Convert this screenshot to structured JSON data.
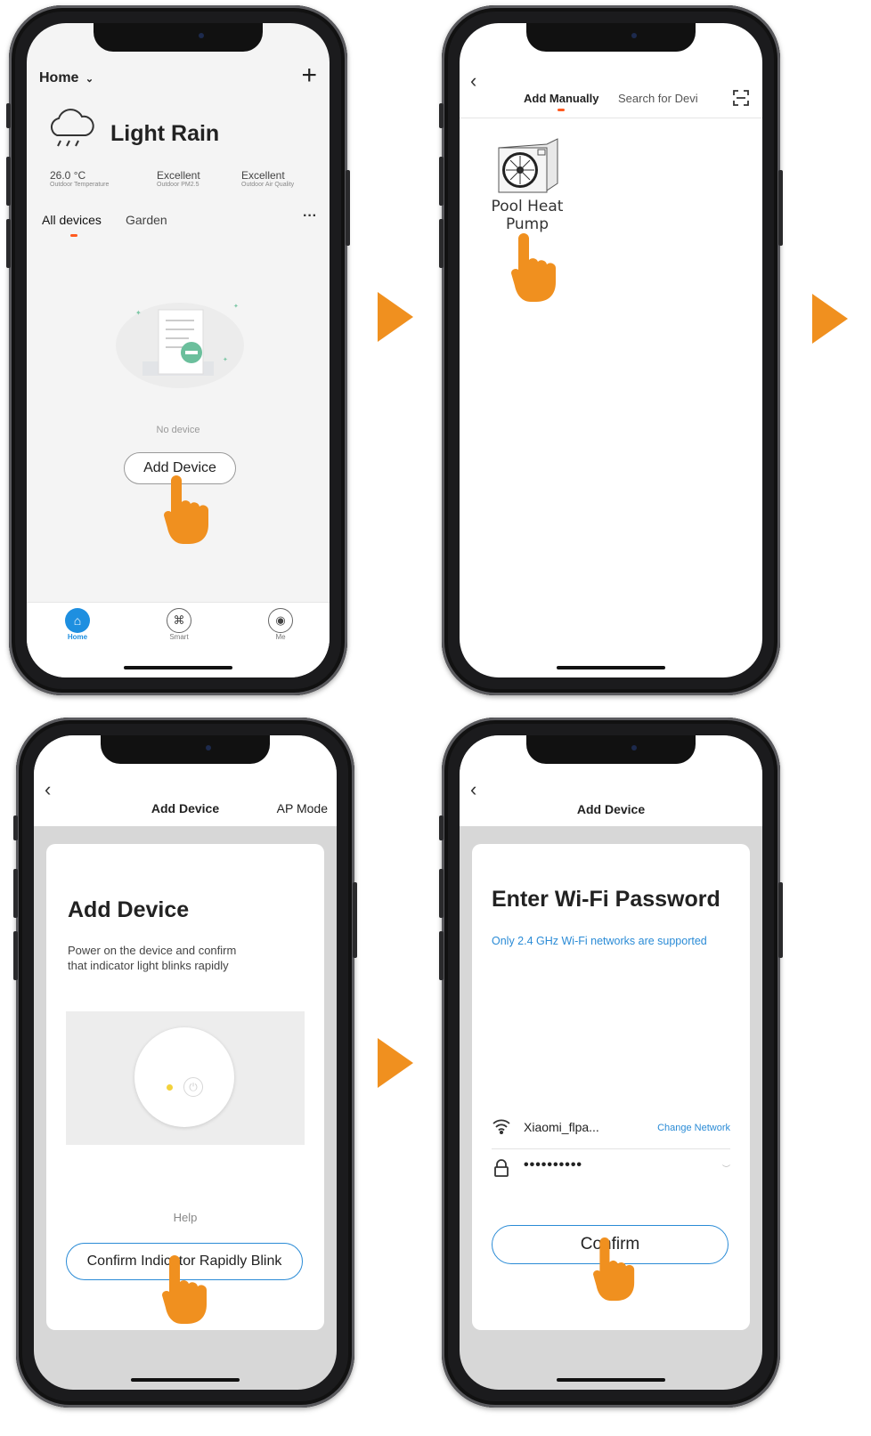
{
  "colors": {
    "accent_orange": "#f0901f",
    "tab_underline": "#ff5a1f",
    "link_blue": "#2a8bd6",
    "home_blue": "#1e8fe0"
  },
  "screen1": {
    "home_label": "Home",
    "weather_title": "Light Rain",
    "stats": [
      {
        "value": "26.0 °C",
        "label": "Outdoor Temperature"
      },
      {
        "value": "Excellent",
        "label": "Outdoor PM2.5"
      },
      {
        "value": "Excellent",
        "label": "Outdoor Air Quality"
      }
    ],
    "tabs": [
      "All devices",
      "Garden"
    ],
    "more": "···",
    "empty_text": "No device",
    "add_button": "Add Device",
    "bottom_nav": [
      "Home",
      "Smart",
      "Me"
    ],
    "icons": {
      "add": "plus-icon",
      "weather": "rain-cloud-icon",
      "chevron": "chevron-down-icon"
    }
  },
  "screen2": {
    "tabs": [
      "Add Manually",
      "Search for Devi"
    ],
    "device_label_line1": "Pool Heat",
    "device_label_line2": "Pump",
    "icons": {
      "back": "back-chevron-icon",
      "scan": "scan-icon"
    }
  },
  "screen3": {
    "header_title": "Add Device",
    "header_right": "AP Mode",
    "card_title": "Add Device",
    "card_desc_line1": "Power on the device and confirm",
    "card_desc_line2": "that indicator light blinks rapidly",
    "help": "Help",
    "confirm_button": "Confirm Indicator Rapidly Blink"
  },
  "screen4": {
    "header_title": "Add Device",
    "card_title": "Enter Wi-Fi Password",
    "subtitle": "Only 2.4 GHz Wi-Fi networks are supported",
    "network_name": "Xiaomi_flpa...",
    "change_network": "Change Network",
    "password_mask": "••••••••••",
    "confirm_button": "Confirm"
  }
}
